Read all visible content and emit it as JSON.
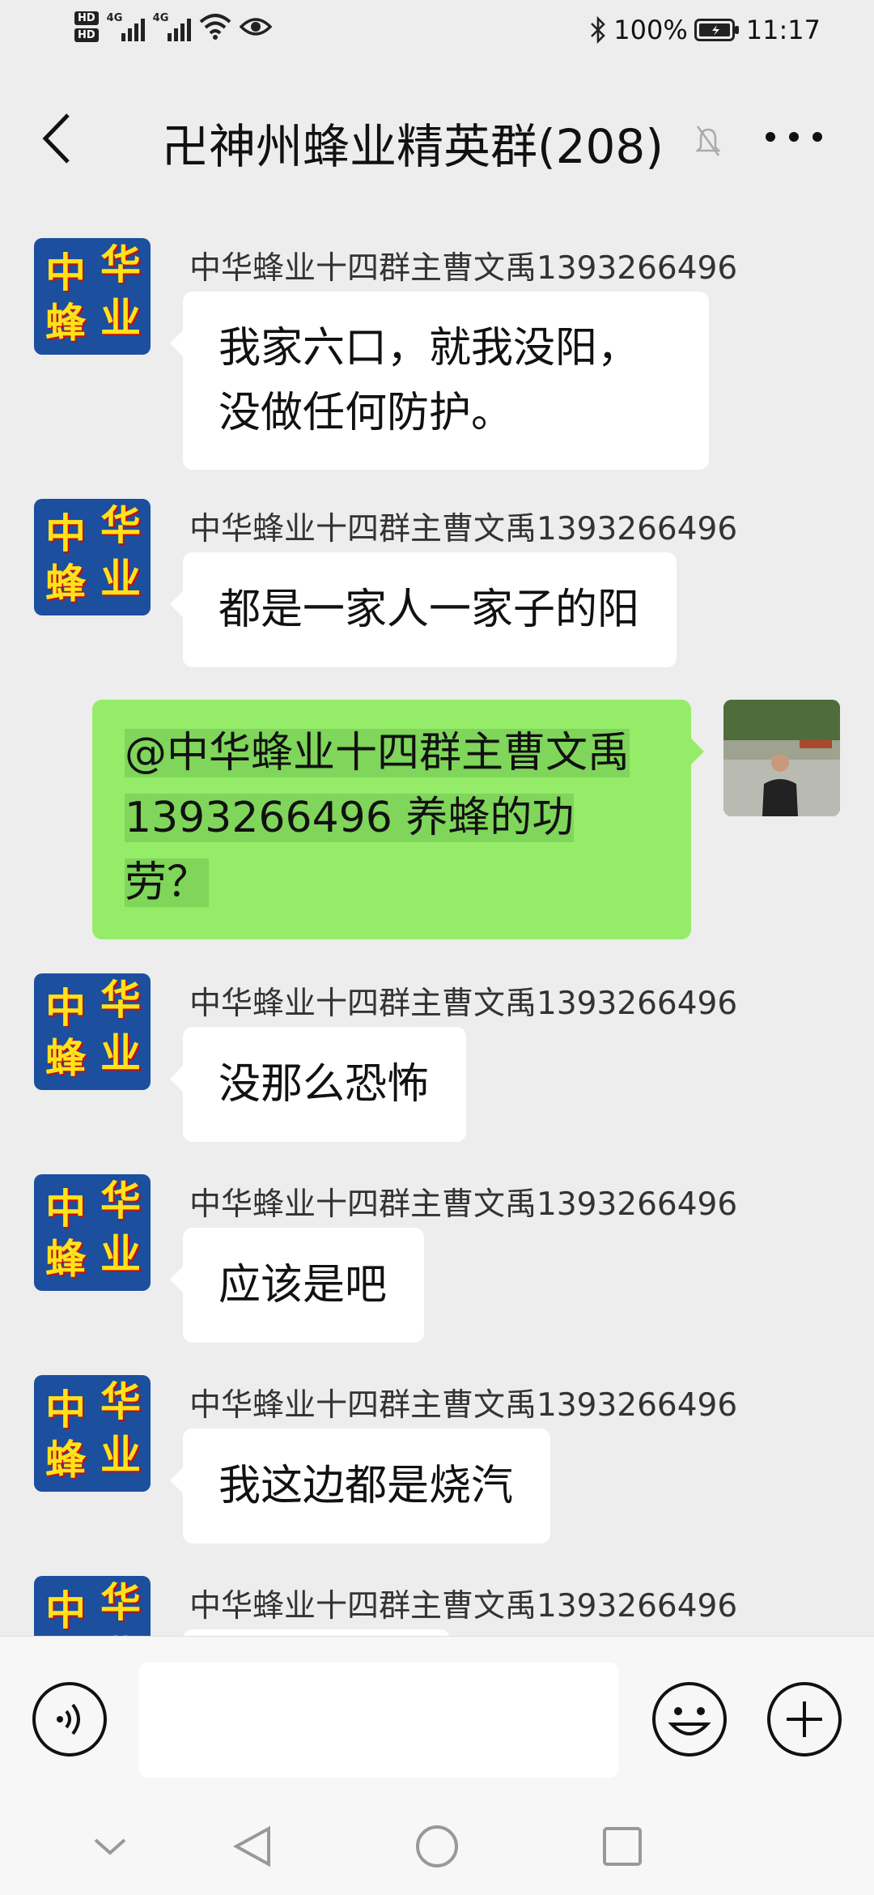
{
  "status_bar": {
    "hd1": "HD",
    "hd2": "HD",
    "net1": "4G",
    "net2": "4G",
    "battery": "100%",
    "time": "11:17",
    "icons": [
      "signal-icon",
      "wifi-icon",
      "eye-icon",
      "bluetooth-icon",
      "battery-icon"
    ]
  },
  "header": {
    "title": "卍神州蜂业精英群(208)",
    "back_icon": "back-icon",
    "mute_icon": "mute-icon",
    "more_icon": "more-icon"
  },
  "avatar_logo_text": [
    "中",
    "华",
    "蜂",
    "业"
  ],
  "messages": [
    {
      "side": "left",
      "sender": "中华蜂业十四群主曹文禹1393266496",
      "text": "我家六口，就我没阳，没做任何防护。"
    },
    {
      "side": "left",
      "sender": "中华蜂业十四群主曹文禹1393266496",
      "text": "都是一家人一家子的阳"
    },
    {
      "side": "right",
      "text": "@中华蜂业十四群主曹文禹 1393266496 养蜂的功劳？"
    },
    {
      "side": "left",
      "sender": "中华蜂业十四群主曹文禹1393266496",
      "text": "没那么恐怖"
    },
    {
      "side": "left",
      "sender": "中华蜂业十四群主曹文禹1393266496",
      "text": "应该是吧"
    },
    {
      "side": "left",
      "sender": "中华蜂业十四群主曹文禹1393266496",
      "text": "我这边都是烧汽"
    },
    {
      "side": "left",
      "sender": "中华蜂业十四群主曹文禹1393266496",
      "text": ""
    }
  ],
  "input_bar": {
    "placeholder": "",
    "voice_icon": "voice-icon",
    "emoji_icon": "emoji-icon",
    "plus_icon": "plus-icon"
  },
  "nav_bar": {
    "icons": [
      "collapse-icon",
      "nav-back-icon",
      "home-icon",
      "recent-apps-icon"
    ]
  },
  "colors": {
    "background": "#ededed",
    "bubble_self": "#95ec69",
    "bubble_other": "#ffffff",
    "avatar_logo_bg": "#1c4f9e",
    "avatar_logo_text": "#ffe21a"
  }
}
